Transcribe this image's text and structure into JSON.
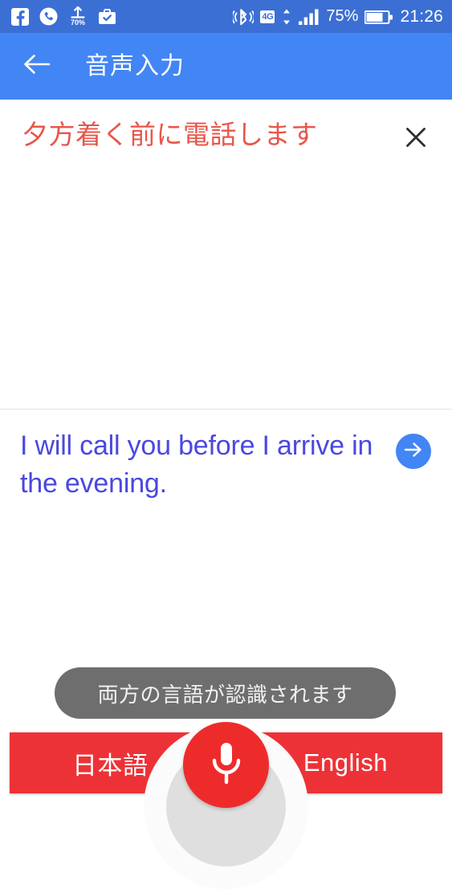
{
  "status_bar": {
    "background_color": "#3b6fd4",
    "left_icons": [
      {
        "name": "facebook-icon",
        "label": "f"
      },
      {
        "name": "phone-call-icon",
        "label": ""
      },
      {
        "name": "download-percent-icon",
        "label": "70%"
      },
      {
        "name": "work-briefcase-icon",
        "label": ""
      }
    ],
    "right_icons": [
      {
        "name": "bluetooth-icon",
        "label": ""
      },
      {
        "name": "network-4g-icon",
        "label": "4G"
      },
      {
        "name": "data-transfer-icon",
        "label": ""
      },
      {
        "name": "signal-bars-icon",
        "label": ""
      }
    ],
    "battery_percent": "75%",
    "clock": "21:26"
  },
  "app_bar": {
    "background_color": "#4285f4",
    "back_icon": "arrow-left-icon",
    "title": "音声入力"
  },
  "source": {
    "text": "夕方着く前に電話します",
    "text_color": "#e8564a",
    "clear_icon": "close-icon"
  },
  "translation": {
    "text": "I will call you before I arrive in the evening.",
    "text_color": "#4a48e0",
    "send_icon": "arrow-right-circle-icon"
  },
  "toast": {
    "message": "両方の言語が認識されます",
    "background_color": "#6e6e6e"
  },
  "bottom_bar": {
    "background_color": "#ed3237",
    "left_language": "日本語",
    "right_language": "English",
    "mic_icon": "microphone-icon",
    "mic_color": "#ee2b2b"
  }
}
